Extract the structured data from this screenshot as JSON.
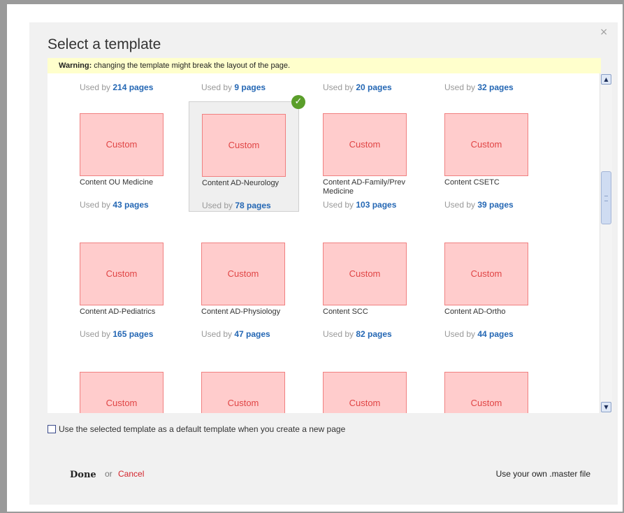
{
  "dialog": {
    "title": "Select a template",
    "close_glyph": "×",
    "warning_bold": "Warning:",
    "warning_text": " changing the template might break the layout of the page."
  },
  "grid": {
    "used_prefix": "Used by ",
    "top_row_counts": [
      "214 pages",
      "9 pages",
      "20 pages",
      "32 pages"
    ],
    "rows": [
      [
        {
          "label": "Custom",
          "name": "Content OU Medicine",
          "used": "43 pages",
          "selected": false
        },
        {
          "label": "Custom",
          "name": "Content AD-Neurology",
          "used": "78 pages",
          "selected": true
        },
        {
          "label": "Custom",
          "name": "Content AD-Family/Prev Medicine",
          "used": "103 pages",
          "selected": false
        },
        {
          "label": "Custom",
          "name": "Content CSETC",
          "used": "39 pages",
          "selected": false
        }
      ],
      [
        {
          "label": "Custom",
          "name": "Content AD-Pediatrics",
          "used": "165 pages",
          "selected": false
        },
        {
          "label": "Custom",
          "name": "Content AD-Physiology",
          "used": "47 pages",
          "selected": false
        },
        {
          "label": "Custom",
          "name": "Content SCC",
          "used": "82 pages",
          "selected": false
        },
        {
          "label": "Custom",
          "name": "Content AD-Ortho",
          "used": "44 pages",
          "selected": false
        }
      ],
      [
        {
          "label": "Custom"
        },
        {
          "label": "Custom"
        },
        {
          "label": "Custom"
        },
        {
          "label": "Custom"
        }
      ]
    ]
  },
  "scrollbar": {
    "up_glyph": "▲",
    "down_glyph": "▼"
  },
  "footer": {
    "default_checkbox_label": "Use the selected template as a default template when you create a new page",
    "done_label": "Done",
    "or_text": "or",
    "cancel_label": "Cancel",
    "master_link": "Use your own .master file"
  },
  "colors": {
    "thumb_fill": "#ffcccc",
    "thumb_border": "#f08080",
    "thumb_text": "#e04545",
    "link_blue": "#2467b4",
    "cancel_red": "#d3232b",
    "warning_bg": "#ffffcc",
    "check_green": "#5a9e2a"
  },
  "icons": {
    "close": "close-icon",
    "selected": "check-icon",
    "scroll_up": "arrow-up-icon",
    "scroll_down": "arrow-down-icon"
  }
}
